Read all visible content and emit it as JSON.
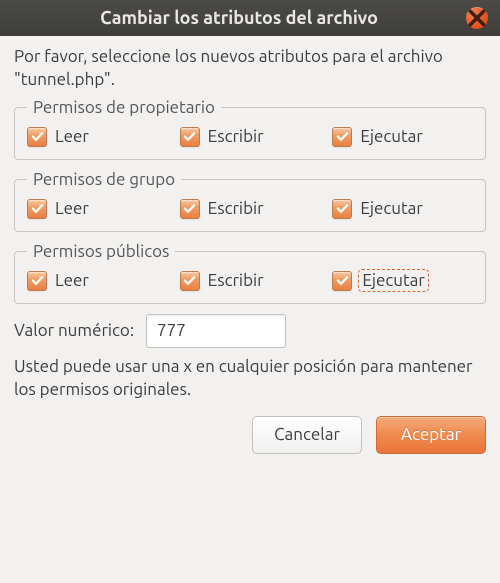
{
  "window": {
    "title": "Cambiar los atributos del archivo"
  },
  "intro": "Por favor, seleccione los nuevos atributos para el archivo \"tunnel.php\".",
  "groups": {
    "owner": {
      "legend": "Permisos de propietario",
      "read": "Leer",
      "write": "Escribir",
      "execute": "Ejecutar"
    },
    "group": {
      "legend": "Permisos de grupo",
      "read": "Leer",
      "write": "Escribir",
      "execute": "Ejecutar"
    },
    "public": {
      "legend": "Permisos públicos",
      "read": "Leer",
      "write": "Escribir",
      "execute": "Ejecutar"
    }
  },
  "numeric": {
    "label": "Valor numérico:",
    "value": "777"
  },
  "note": "Usted puede usar una x en cualquier posición para mantener los permisos originales.",
  "buttons": {
    "cancel": "Cancelar",
    "accept": "Aceptar"
  }
}
